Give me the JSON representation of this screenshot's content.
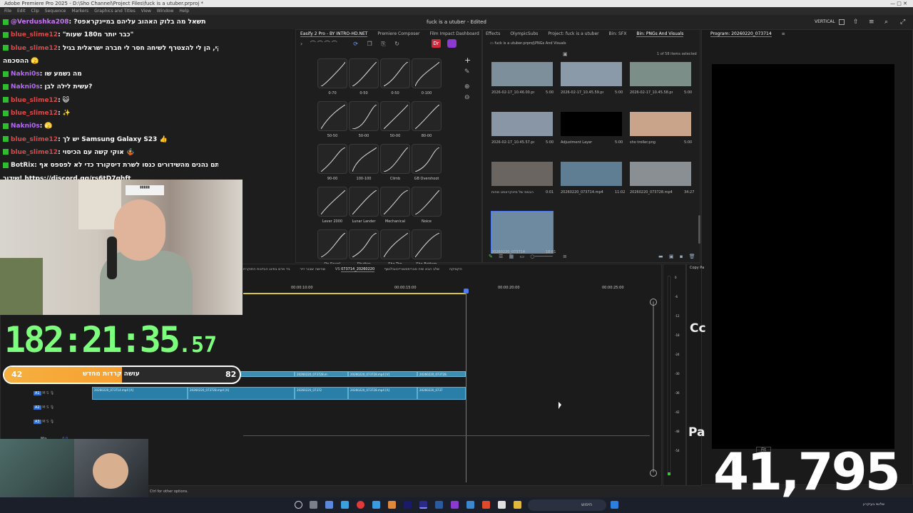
{
  "window": {
    "title": "Adobe Premiere Pro 2025 - D:\\Sho Channel\\Project Files\\fuck is a utuber.prproj *",
    "subtitle": "fuck is a utuber - Edited",
    "menu": [
      "File",
      "Edit",
      "Clip",
      "Sequence",
      "Markers",
      "Graphics and Titles",
      "View",
      "Window",
      "Help"
    ],
    "workspace_label": "VERTICAL"
  },
  "chat": {
    "messages": [
      {
        "user": "@Verdushka208",
        "text": ": ?תשאל מה בלוק האהוב עליהם במיינקראפט",
        "user_color": "#c678f0"
      },
      {
        "user": "blue_slime12",
        "text": ": \"כבר יותר מ180 שעות\"",
        "user_color": "#d94a4a"
      },
      {
        "user": "blue_slime12",
        "text": ": אוקי, הן לי להצטרף לשיחה חסר לי חברה ישראלית בגיל",
        "user_color": "#d94a4a"
      },
      {
        "user": "",
        "text": "ההסכמה 🫣",
        "user_color": "#ffffff"
      },
      {
        "user": "Nakni0s",
        "text": ": מה נשמע שו",
        "user_color": "#b46cf2"
      },
      {
        "user": "Nakni0s",
        "text": ": עשית לילה לבן?",
        "user_color": "#b46cf2"
      },
      {
        "user": "blue_slime12",
        "text": ": 😺",
        "user_color": "#d94a4a"
      },
      {
        "user": "blue_slime12",
        "text": ": ✨",
        "user_color": "#d94a4a"
      },
      {
        "user": "Nakni0s",
        "text": ": 🫣",
        "user_color": "#b46cf2"
      },
      {
        "user": "blue_slime12",
        "text": ": יש לך Samsung Galaxy S23 👍",
        "user_color": "#d94a4a"
      },
      {
        "user": "blue_slime12",
        "text": ": אוקי קשה עם הכיסוי 🤹",
        "user_color": "#d94a4a"
      },
      {
        "user": "BotRix",
        "text": ": אם אתם נהנים מהשידורים כנסו לשרת דיסקורד כדי לא לפספס אף",
        "user_color": "#f0f0f0"
      },
      {
        "user": "",
        "text": "שידור! https://discord.gg/rs6tD7ghft",
        "user_color": "#ffffff"
      }
    ]
  },
  "overlay": {
    "timer_main": "182:21:35",
    "timer_fraction": ".57",
    "progress_left": "42",
    "progress_right": "82",
    "progress_text": "עושה קרדות מחדש",
    "progress_fraction": 0.5,
    "viewer_count": "41,795"
  },
  "effects_panel": {
    "tabs": [
      "Easify 2 Pro - BY INTRO-HD.NET",
      "Premiere Composer",
      "Film Impact Dashboard"
    ],
    "curves": [
      {
        "label": "0-70"
      },
      {
        "label": "0-50"
      },
      {
        "label": "0-50"
      },
      {
        "label": "0-100"
      },
      {
        "label": "50-50"
      },
      {
        "label": "50-00"
      },
      {
        "label": "50-00"
      },
      {
        "label": "80-00"
      },
      {
        "label": "90-00"
      },
      {
        "label": "100-100"
      },
      {
        "label": "Climb"
      },
      {
        "label": "GB Overshoot"
      },
      {
        "label": "Lever 2000"
      },
      {
        "label": "Lunar Lander"
      },
      {
        "label": "Mechanical"
      },
      {
        "label": "Noice"
      },
      {
        "label": "On Snap!"
      },
      {
        "label": "Shutter"
      },
      {
        "label": "Sho Top"
      },
      {
        "label": "Sho Bottom"
      }
    ]
  },
  "project_panel": {
    "tabs": [
      "Effects",
      "OlympicSubs",
      "Project: fuck is a utuber",
      "Bin: SFX",
      "Bin: PNGs And Visuals"
    ],
    "path": "fuck is a utuber.prproj\\PNGs And Visuals",
    "selection_info": "1 of 58 items selected",
    "items": [
      {
        "name": "2026-02-17_10.46.00.png",
        "duration": "5:00",
        "color": "#7d8f9b"
      },
      {
        "name": "2026-02-17_10.45.59.png",
        "duration": "5:00",
        "color": "#8a9aa8"
      },
      {
        "name": "2026-02-17_10.45.58.png",
        "duration": "5:00",
        "color": "#7c8e88"
      },
      {
        "name": "2026-02-17_10.45.57.png",
        "duration": "5:00",
        "color": "#8896a6"
      },
      {
        "name": "Adjustment Layer",
        "duration": "5:00",
        "color": "#000000"
      },
      {
        "name": "sho troller.png",
        "duration": "5:00",
        "color": "#c9a38a"
      },
      {
        "name": "הבמפ של מיינקראפט מחות",
        "duration": "0:01",
        "color": "#6a6560"
      },
      {
        "name": "20260220_073714.mp4",
        "duration": "11:02",
        "color": "#5f7d93"
      },
      {
        "name": "20260220_073728.mp4",
        "duration": "34:27",
        "color": "#8a8f93"
      },
      {
        "name": "20260220_073714",
        "duration": "18:01",
        "color": "#6e8aa0"
      }
    ]
  },
  "program_monitor": {
    "title": "Program: 20260220_073714",
    "text_a": "Cc",
    "text_b": "Pa",
    "fit_label": "Fit",
    "side_tab": "Copy Pa"
  },
  "timeline": {
    "tabs": [
      "שהישה שבגר זייר",
      "בד אדם בפינג הבדנות",
      "התוקרת VS הקטיקה",
      "שלב הבא שיה סבריפסטורייכוובלגשף",
      "20260220_073714"
    ],
    "timecodes": [
      "00:00:10:00",
      "00:00:15:00",
      "00:00:20:00",
      "00:00:25:00"
    ],
    "video_clips": [
      {
        "name": "20260220_073728.m"
      },
      {
        "name": "20260220_073728.m"
      },
      {
        "name": "20260220_073728.mp4 [V]"
      },
      {
        "name": "20260220_073728."
      }
    ],
    "audio_clips": [
      {
        "name": "20260220_073714.mp4 [A]"
      },
      {
        "name": "20260220_073728.mp4 [A]"
      },
      {
        "name": "20260220_07372"
      },
      {
        "name": "20260220_073728.mp4 [A]"
      },
      {
        "name": "20260220_0737"
      }
    ],
    "track_labels": [
      "A1",
      "A2",
      "A3"
    ],
    "mix_label": "Mix",
    "mix_value": "0.0",
    "meter_scale": [
      "0",
      "-6",
      "-12",
      "-18",
      "-24",
      "-30",
      "-36",
      "-42",
      "-48",
      "-54"
    ]
  },
  "status": {
    "hint": "Ctrl for other options."
  },
  "taskbar": {
    "search_placeholder": "חיפוש",
    "tray_text": "שלושי בעיקרון"
  }
}
